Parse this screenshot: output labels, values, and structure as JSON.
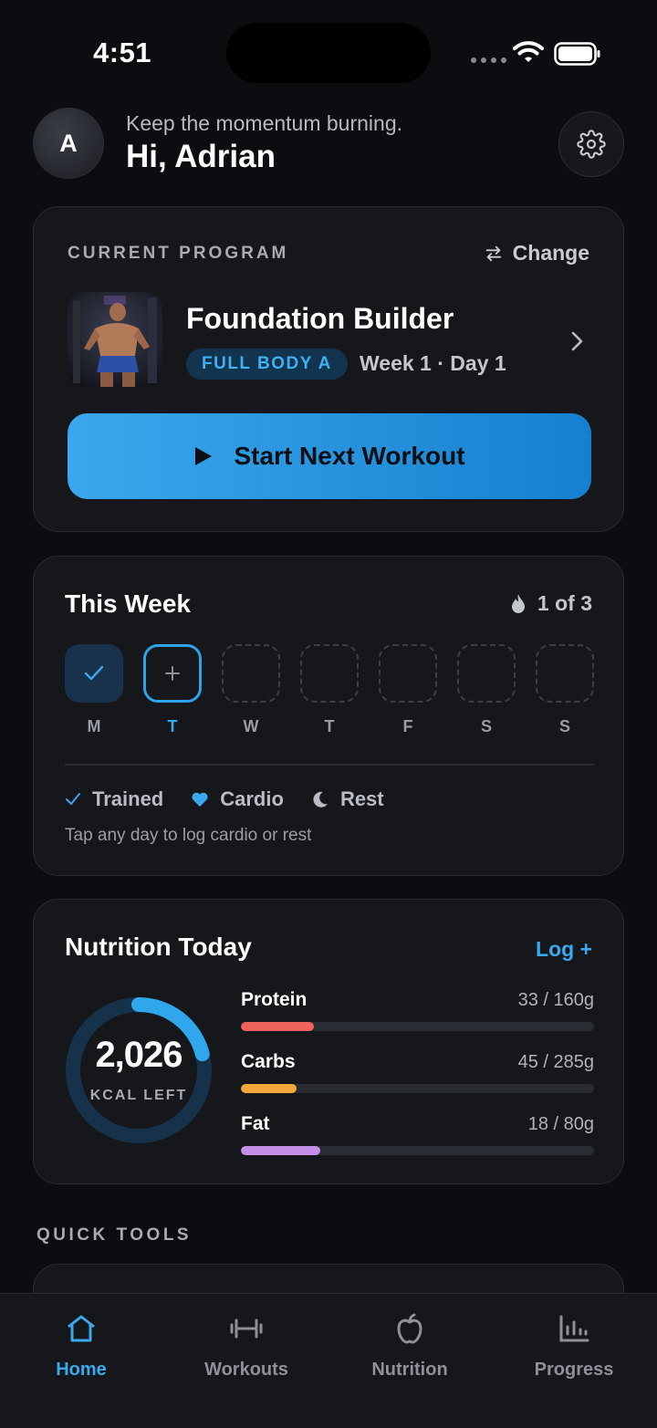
{
  "status_bar": {
    "time": "4:51"
  },
  "header": {
    "avatar_initial": "A",
    "subtitle": "Keep the momentum burning.",
    "greeting": "Hi, Adrian"
  },
  "program": {
    "section_label": "CURRENT PROGRAM",
    "change_label": "Change",
    "name": "Foundation Builder",
    "tag": "FULL BODY A",
    "schedule": "Week 1 · Day 1",
    "start_label": "Start Next Workout"
  },
  "week": {
    "title": "This Week",
    "streak": "1 of 3",
    "days": [
      {
        "label": "M",
        "state": "done"
      },
      {
        "label": "T",
        "state": "today"
      },
      {
        "label": "W",
        "state": "empty"
      },
      {
        "label": "T",
        "state": "empty"
      },
      {
        "label": "F",
        "state": "empty"
      },
      {
        "label": "S",
        "state": "empty"
      },
      {
        "label": "S",
        "state": "empty"
      }
    ],
    "legend": {
      "trained": "Trained",
      "cardio": "Cardio",
      "rest": "Rest"
    },
    "hint": "Tap any day to log cardio or rest"
  },
  "nutrition": {
    "title": "Nutrition Today",
    "log_label": "Log +",
    "kcal_left": "2,026",
    "kcal_unit": "KCAL LEFT",
    "kcal_progress": 0.21,
    "macros": [
      {
        "name": "Protein",
        "value": "33 / 160g",
        "progress": 0.206,
        "color": "#f0625c"
      },
      {
        "name": "Carbs",
        "value": "45 / 285g",
        "progress": 0.158,
        "color": "#f2a73a"
      },
      {
        "name": "Fat",
        "value": "18 / 80g",
        "progress": 0.225,
        "color": "#c58ee6"
      }
    ]
  },
  "quick_tools": {
    "label": "QUICK TOOLS"
  },
  "tabs": [
    {
      "label": "Home",
      "icon": "home-icon",
      "active": true
    },
    {
      "label": "Workouts",
      "icon": "dumbbell-icon",
      "active": false
    },
    {
      "label": "Nutrition",
      "icon": "apple-icon",
      "active": false
    },
    {
      "label": "Progress",
      "icon": "bar-chart-icon",
      "active": false
    }
  ],
  "colors": {
    "accent": "#3aa8ec",
    "background": "#0c0d10",
    "card": "#16171b"
  }
}
